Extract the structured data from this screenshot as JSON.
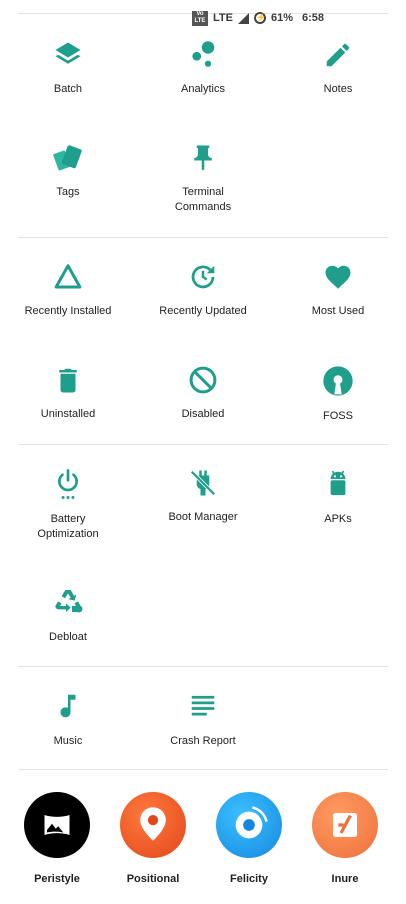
{
  "status_bar": {
    "network": "LTE",
    "battery": "61%",
    "time": "6:58"
  },
  "sections": [
    {
      "items": [
        {
          "label": "Batch",
          "icon": "layers-icon"
        },
        {
          "label": "Analytics",
          "icon": "bubble-chart-icon"
        },
        {
          "label": "Notes",
          "icon": "pencil-icon"
        },
        {
          "label": "Tags",
          "icon": "tag-cards-icon"
        },
        {
          "label": "Terminal Commands",
          "icon": "push-pin-icon"
        }
      ]
    },
    {
      "items": [
        {
          "label": "Recently Installed",
          "icon": "triangle-icon"
        },
        {
          "label": "Recently Updated",
          "icon": "update-clock-icon"
        },
        {
          "label": "Most Used",
          "icon": "heart-icon"
        },
        {
          "label": "Uninstalled",
          "icon": "trash-icon"
        },
        {
          "label": "Disabled",
          "icon": "block-icon"
        },
        {
          "label": "FOSS",
          "icon": "open-source-icon"
        }
      ]
    },
    {
      "items": [
        {
          "label": "Battery Optimization",
          "icon": "power-icon"
        },
        {
          "label": "Boot Manager",
          "icon": "power-off-plug-icon"
        },
        {
          "label": "APKs",
          "icon": "android-icon"
        },
        {
          "label": "Debloat",
          "icon": "recycle-icon"
        }
      ]
    },
    {
      "items": [
        {
          "label": "Music",
          "icon": "music-note-icon"
        },
        {
          "label": "Crash Report",
          "icon": "lines-icon"
        }
      ]
    }
  ],
  "apps": [
    {
      "label": "Peristyle",
      "icon": "image-frame-icon",
      "color": "#000000"
    },
    {
      "label": "Positional",
      "icon": "location-pin-icon",
      "color": "#f25a28"
    },
    {
      "label": "Felicity",
      "icon": "record-icon",
      "color": "#1a9bf0"
    },
    {
      "label": "Inure",
      "icon": "inure-logo-icon",
      "color": "#f4824a"
    }
  ],
  "accent_color": "#1f9e8c"
}
